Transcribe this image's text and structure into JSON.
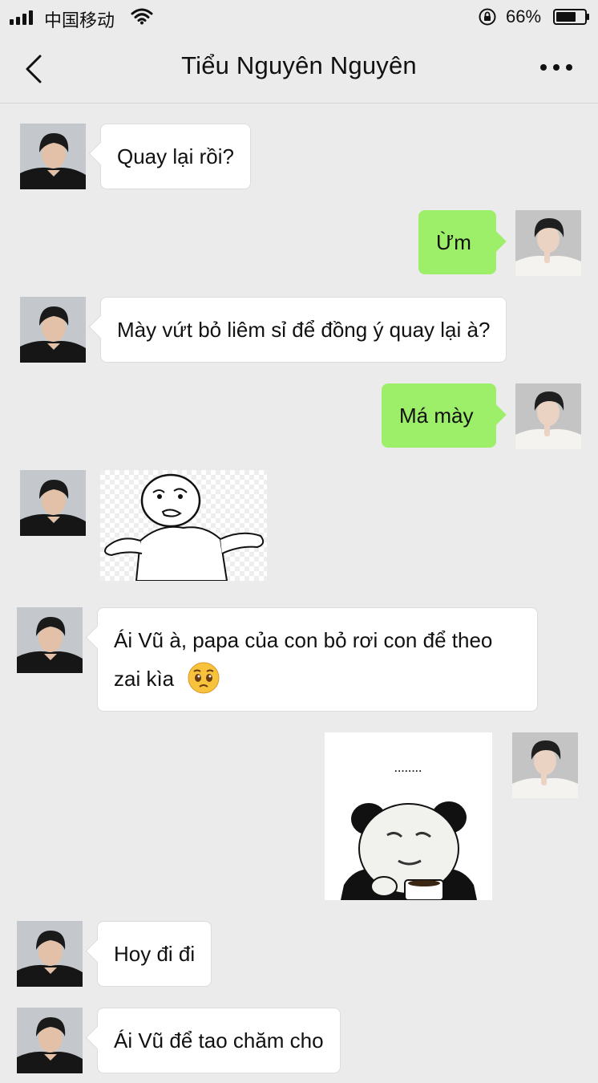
{
  "status": {
    "carrier": "中国移动",
    "battery": "66%"
  },
  "nav": {
    "title": "Tiểu Nguyên Nguyên"
  },
  "messages": [
    {
      "side": "in",
      "type": "text",
      "text": "Quay lại rồi?"
    },
    {
      "side": "out",
      "type": "text",
      "text": "Ừm"
    },
    {
      "side": "in",
      "type": "text",
      "text": "Mày vứt bỏ liêm sỉ để đồng ý quay lại à?"
    },
    {
      "side": "out",
      "type": "text",
      "text": "Má mày"
    },
    {
      "side": "in",
      "type": "sticker",
      "sticker": "shrug-meme-sticker"
    },
    {
      "side": "in",
      "type": "text",
      "line1": "Ái Vũ à, papa của con bỏ rơi con để theo",
      "line2": "zai kìa",
      "emoji": "pleading-face-emoji"
    },
    {
      "side": "out",
      "type": "sticker",
      "sticker": "panda-coffee-sticker",
      "caption": "........"
    },
    {
      "side": "in",
      "type": "text",
      "text": "Hoy đi đi"
    },
    {
      "side": "in",
      "type": "text",
      "text": "Ái Vũ để tao chăm cho"
    }
  ],
  "colors": {
    "background": "#ebebeb",
    "outgoing_bubble": "#9def6a",
    "incoming_bubble": "#ffffff"
  }
}
